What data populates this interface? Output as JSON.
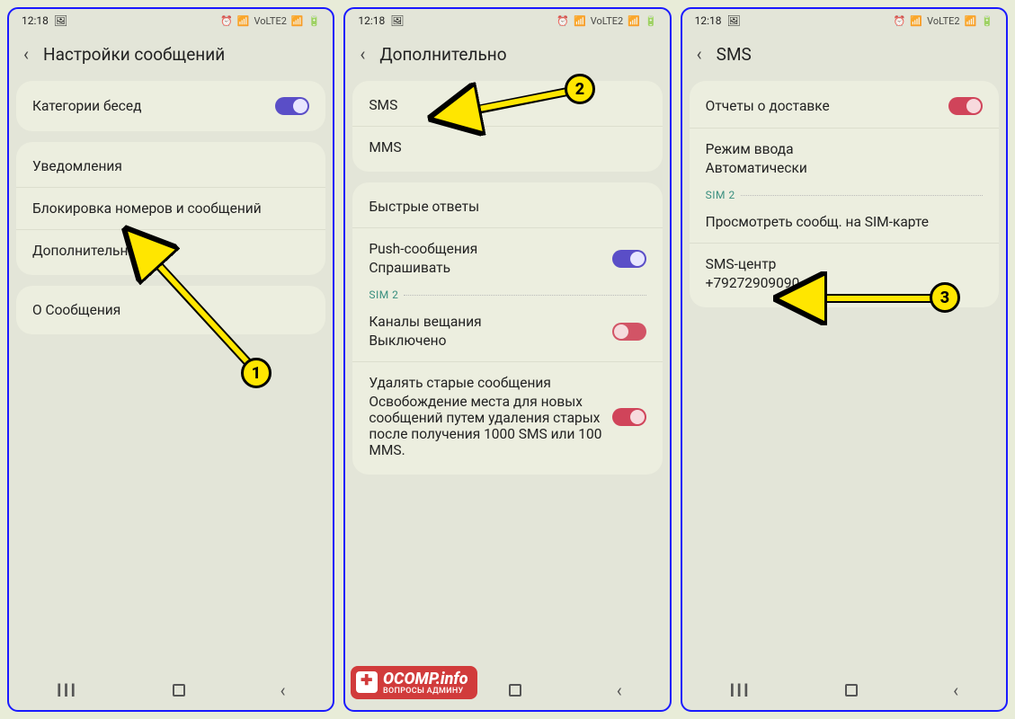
{
  "status": {
    "time": "12:18",
    "icons": [
      "⏰",
      "📶",
      "VoLTE2",
      "📶",
      "🔋"
    ]
  },
  "nav": {
    "recent": "III",
    "home": "○",
    "back": "‹"
  },
  "screens": [
    {
      "title": "Настройки сообщений",
      "groups": [
        [
          {
            "label": "Категории бесед",
            "toggle": "on-purple"
          }
        ],
        [
          {
            "label": "Уведомления"
          },
          {
            "label": "Блокировка номеров и сообщений"
          },
          {
            "label": "Дополнительно"
          }
        ],
        [
          {
            "label": "О Сообщения"
          }
        ]
      ]
    },
    {
      "title": "Дополнительно",
      "groups": [
        [
          {
            "label": "SMS"
          },
          {
            "label": "MMS"
          }
        ],
        [
          {
            "label": "Быстрые ответы"
          },
          {
            "label": "Push-сообщения",
            "sub": "Спрашивать",
            "toggle": "on-purple"
          },
          {
            "sim_header": "SIM 2"
          },
          {
            "label": "Каналы вещания",
            "sub": "Выключено",
            "toggle": "off-red"
          },
          {
            "label": "Удалять старые сообщения",
            "hint": "Освобождение места для новых сообщений путем удаления старых после получения 1000 SMS или 100 MMS.",
            "toggle": "on-red"
          }
        ]
      ]
    },
    {
      "title": "SMS",
      "groups": [
        [
          {
            "label": "Отчеты о доставке",
            "toggle": "on-red"
          },
          {
            "label": "Режим ввода",
            "sub": "Автоматически"
          },
          {
            "sim_header": "SIM 2"
          },
          {
            "label": "Просмотреть сообщ. на SIM-карте"
          },
          {
            "label": "SMS-центр",
            "sub": "+79272909090"
          }
        ]
      ]
    }
  ],
  "badges": {
    "one": "1",
    "two": "2",
    "three": "3"
  },
  "logo": {
    "title": "OCOMP.info",
    "sub": "ВОПРОСЫ АДМИНУ"
  }
}
